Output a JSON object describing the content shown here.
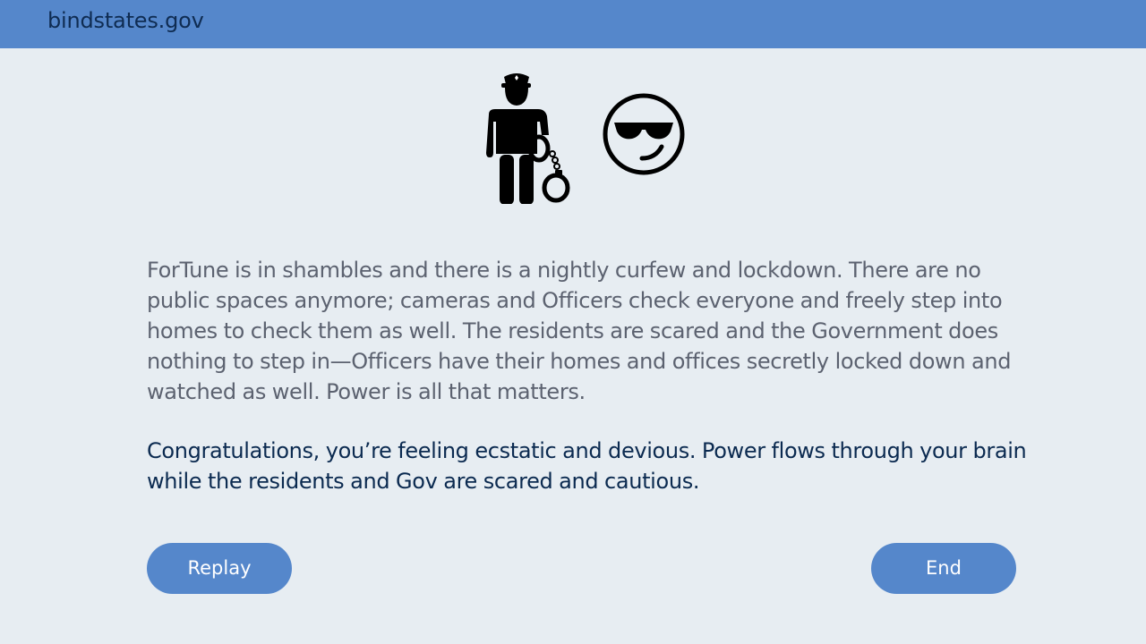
{
  "header": {
    "site_title": "bindstates.gov",
    "background_color": "#5587cb"
  },
  "icons": {
    "left": "police-officer-with-handcuffs-icon",
    "right": "sunglasses-smirk-face-icon"
  },
  "content": {
    "story": "ForTune is in shambles and there is a nightly curfew and lockdown. There are no public spaces anymore; cameras and Officers check everyone and freely step into homes to check them as well. The residents are scared and the Government does nothing to step in—Officers have their homes and offices secretly locked down and watched as well. Power is all that matters.",
    "result": "Congratulations, you’re feeling ecstatic and devious. Power flows through your brain while the residents and Gov are scared and cautious."
  },
  "buttons": {
    "replay_label": "Replay",
    "end_label": "End"
  }
}
